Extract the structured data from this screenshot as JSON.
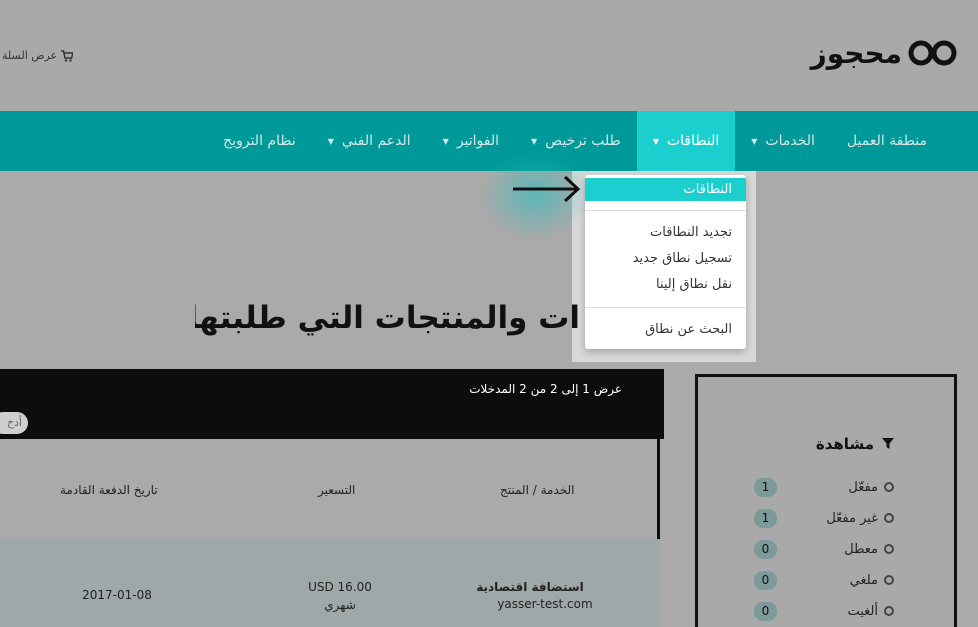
{
  "header": {
    "logo_text": "محجوز",
    "cart_label": "عرض السلة"
  },
  "nav": {
    "items": [
      {
        "label": "منطقة العميل",
        "dropdown": false,
        "active": false
      },
      {
        "label": "الخدمات",
        "dropdown": true,
        "active": false
      },
      {
        "label": "النطاقات",
        "dropdown": true,
        "active": true
      },
      {
        "label": "طلب ترخيص",
        "dropdown": true,
        "active": false
      },
      {
        "label": "الفواتير",
        "dropdown": true,
        "active": false
      },
      {
        "label": "الدعم الفني",
        "dropdown": true,
        "active": false
      },
      {
        "label": "نظام الترويج",
        "dropdown": false,
        "active": false
      }
    ]
  },
  "dropdown": {
    "items": [
      "النطاقات",
      "تجديد النطاقات",
      "تسجيل نطاق جديد",
      "نقل نطاق إلينا",
      "البحث عن نطاق"
    ]
  },
  "page": {
    "title": "ات والمنتجات التي طلبتها"
  },
  "sidebar": {
    "title": "مشاهدة",
    "filters": [
      {
        "label": "مفعّل",
        "count": "1"
      },
      {
        "label": "غير مفعّل",
        "count": "1"
      },
      {
        "label": "معطل",
        "count": "0"
      },
      {
        "label": "ملغي",
        "count": "0"
      },
      {
        "label": "ألغيت",
        "count": "0"
      }
    ]
  },
  "table": {
    "info": "عرض 1 إلى 2 من 2 المدخلات",
    "prev_label": "أدخ",
    "headers": [
      "الخدمة / المنتج",
      "التسعير",
      "تاريخ الدفعة القادمة"
    ],
    "rows": [
      {
        "product": "استضافة اقتصادية",
        "domain": "yasser-test.com",
        "price": "USD 16.00",
        "cycle": "شهري",
        "next_due": "2017-01-08"
      }
    ]
  },
  "colors": {
    "nav_bg": "#009999",
    "nav_active": "#1ccfcf",
    "page_bg": "#aaaaaa"
  }
}
